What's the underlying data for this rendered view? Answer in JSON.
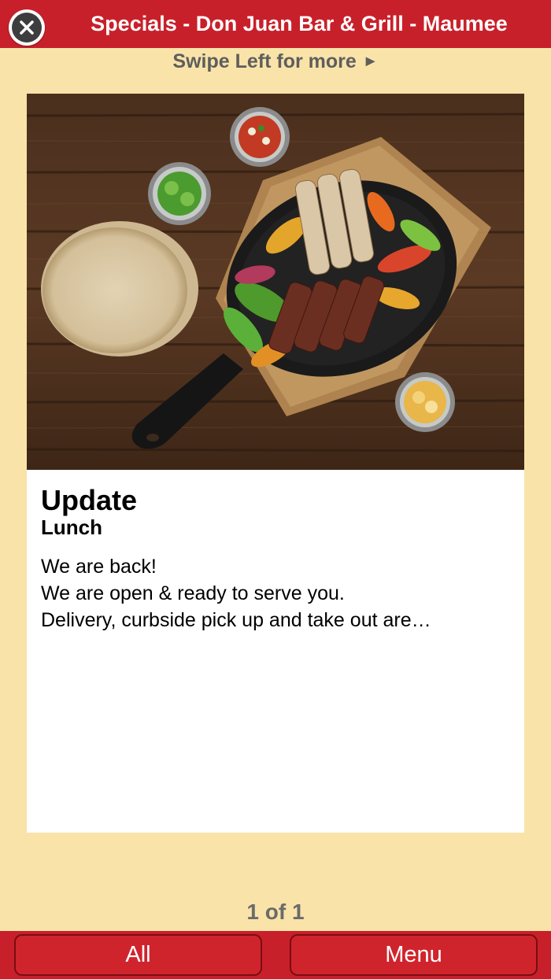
{
  "header": {
    "title": "Specials - Don Juan Bar & Grill - Maumee",
    "close_icon": "close-circle-icon"
  },
  "swipe_hint": {
    "text": "Swipe Left for more",
    "arrow": "►"
  },
  "special": {
    "image_alt": "fajitas-skillet-image",
    "title": "Update",
    "subtitle": "Lunch",
    "description_lines": [
      "We are back!",
      "We are open & ready to serve you.",
      "Delivery, curbside pick up and take out are…"
    ]
  },
  "pager": {
    "text": "1 of 1"
  },
  "bottom_bar": {
    "all_label": "All",
    "menu_label": "Menu"
  },
  "colors": {
    "brand_red": "#c8202a",
    "background": "#f9e3a8"
  }
}
